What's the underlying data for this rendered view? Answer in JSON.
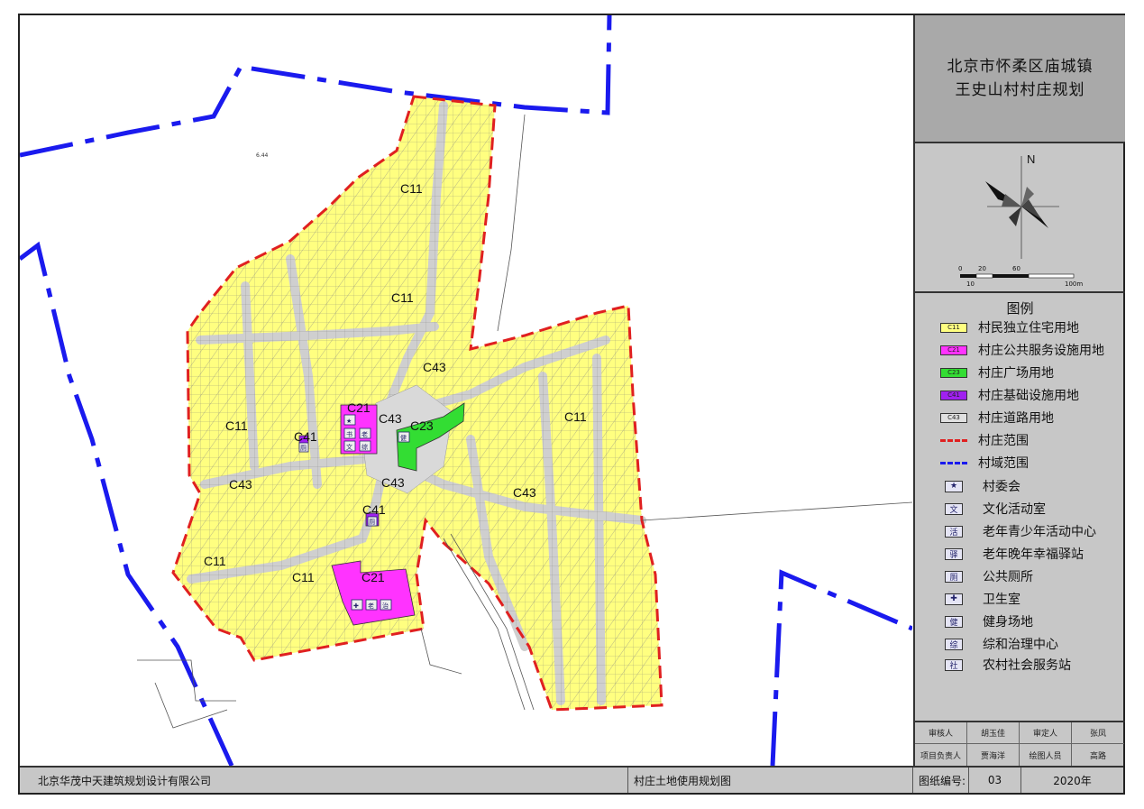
{
  "title": {
    "line1": "北京市怀柔区庙城镇",
    "line2": "王史山村村庄规划"
  },
  "compass": {
    "north_label": "N",
    "scale_top": [
      "0",
      "20",
      "60"
    ],
    "scale_bottom": [
      "10",
      "100m"
    ]
  },
  "map": {
    "labels": {
      "c11_north": "C11",
      "c11_center": "C11",
      "c11_west": "C11",
      "c11_east": "C11",
      "c11_southwest": "C11",
      "c11_south": "C11",
      "c43_center_north": "C43",
      "c43_center": "C43",
      "c43_center_south": "C43",
      "c43_west": "C43",
      "c43_east": "C43",
      "c21_north": "C21",
      "c21_south": "C21",
      "c23": "C23",
      "c41_west": "C41",
      "c41_center": "C41",
      "small_text": "6.44"
    },
    "facility_glyphs": {
      "star": "★",
      "book": "书",
      "old": "老",
      "culture": "文",
      "comp": "综",
      "plaza": "健",
      "wc": "厕",
      "clinic": "✚",
      "elder": "老",
      "service": "治"
    }
  },
  "legend": {
    "title": "图例",
    "landuse": [
      {
        "code": "C11",
        "label": "村民独立住宅用地",
        "color": "#ffff80"
      },
      {
        "code": "C21",
        "label": "村庄公共服务设施用地",
        "color": "#ff33ff"
      },
      {
        "code": "C23",
        "label": "村庄广场用地",
        "color": "#33dd33"
      },
      {
        "code": "C41",
        "label": "村庄基础设施用地",
        "color": "#a020f0"
      },
      {
        "code": "C43",
        "label": "村庄道路用地",
        "color": "#e0e0e0"
      }
    ],
    "lines": [
      {
        "label": "村庄范围",
        "color": "#e02020",
        "style": "dash"
      },
      {
        "label": "村域范围",
        "color": "#1a1aee",
        "style": "dashdot"
      }
    ],
    "facilities": [
      {
        "icon": "★",
        "label": "村委会"
      },
      {
        "icon": "文",
        "label": "文化活动室"
      },
      {
        "icon": "活",
        "label": "老年青少年活动中心"
      },
      {
        "icon": "驿",
        "label": "老年晚年幸福驿站"
      },
      {
        "icon": "厕",
        "label": "公共厕所"
      },
      {
        "icon": "✚",
        "label": "卫生室"
      },
      {
        "icon": "健",
        "label": "健身场地"
      },
      {
        "icon": "综",
        "label": "综和治理中心"
      },
      {
        "icon": "社",
        "label": "农村社会服务站"
      }
    ]
  },
  "signature": {
    "r1c1": "审核人",
    "r1c2": "胡玉佳",
    "r1c3": "审定人",
    "r1c4": "张凤",
    "r2c1": "项目负责人",
    "r2c2": "贾海洋",
    "r2c3": "绘图人员",
    "r2c4": "高路"
  },
  "bottom": {
    "company": "北京华茂中天建筑规划设计有限公司",
    "drawing_name": "村庄土地使用规划图",
    "drawing_no_label": "图纸编号:",
    "drawing_no": "03",
    "year": "2020年"
  }
}
